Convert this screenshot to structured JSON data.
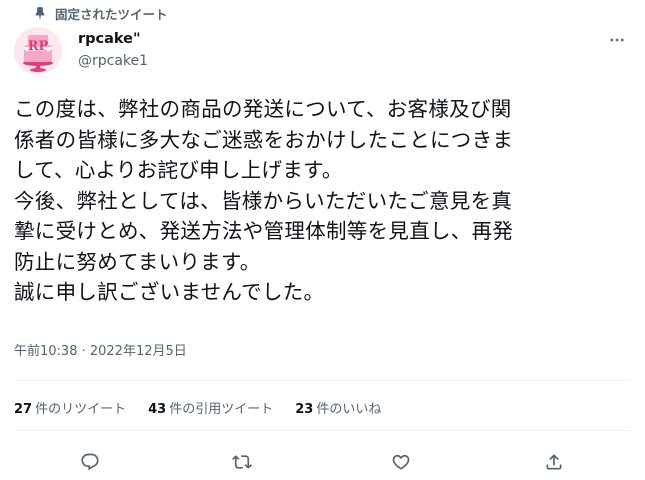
{
  "pinned": {
    "label": "固定されたツイート",
    "icon": "pin-icon"
  },
  "author": {
    "name": "rpcake\"",
    "handle": "@rpcake1",
    "avatar_text": "RP",
    "avatar_color": "#e63b7a"
  },
  "tweet": {
    "text": "この度は、弊社の商品の発送について、お客様及び関\n係者の皆様に多大なご迷惑をおかけしたことにつきま\nして、心よりお詫び申し上げます。\n今後、弊社としては、皆様からいただいたご意見を真\n摯に受けとめ、発送方法や管理体制等を見直し、再発\n防止に努めてまいります。\n誠に申し訳ございませんでした。",
    "timestamp": "午前10:38 · 2022年12月5日"
  },
  "stats": [
    {
      "count": "27",
      "label": "件のリツイート"
    },
    {
      "count": "43",
      "label": "件の引用ツイート"
    },
    {
      "count": "23",
      "label": "件のいいね"
    }
  ],
  "actions": {
    "reply_icon": "reply-icon",
    "retweet_icon": "retweet-icon",
    "like_icon": "like-icon",
    "share_icon": "share-icon"
  },
  "colors": {
    "text": "#0f1419",
    "secondary": "#536471",
    "divider": "#eff3f4"
  }
}
